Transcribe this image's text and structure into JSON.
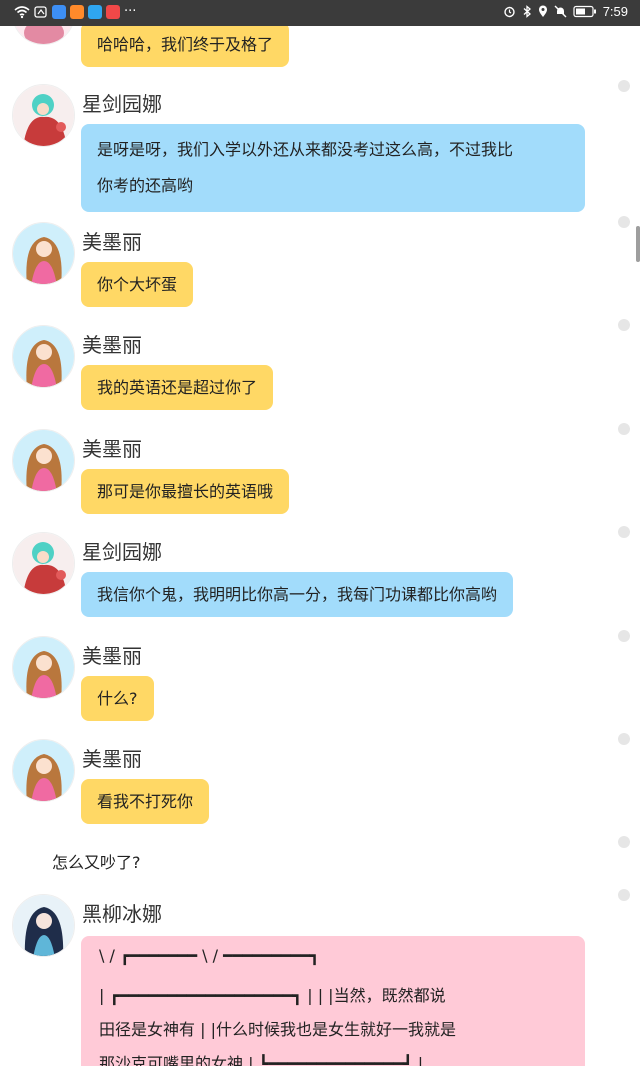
{
  "status_bar": {
    "time": "7:59",
    "overflow": "···",
    "icons": [
      "wifi-icon",
      "signal-icon",
      "cloud-app-icon",
      "orange-app-icon",
      "blue-app-icon",
      "red-app-icon",
      "alarm-icon",
      "bluetooth-icon",
      "location-icon",
      "mute-icon",
      "battery-icon"
    ]
  },
  "messages": [
    {
      "type": "bubble",
      "color": "yellow",
      "text": "哈哈哈，我们终于及格了"
    },
    {
      "type": "bubble",
      "color": "blue",
      "name": "星剑园娜",
      "lines": [
        "是呀是呀，我们入学以外还从来都没考过这么高，不过我比",
        "你考的还高哟"
      ]
    },
    {
      "type": "bubble",
      "color": "yellow",
      "name": "美墨丽",
      "text": "你个大坏蛋"
    },
    {
      "type": "bubble",
      "color": "yellow",
      "name": "美墨丽",
      "text": "我的英语还是超过你了"
    },
    {
      "type": "bubble",
      "color": "yellow",
      "name": "美墨丽",
      "text": "那可是你最擅长的英语哦"
    },
    {
      "type": "bubble",
      "color": "blue",
      "name": "星剑园娜",
      "text": "我信你个鬼，我明明比你高一分，我每门功课都比你高哟"
    },
    {
      "type": "bubble",
      "color": "yellow",
      "name": "美墨丽",
      "text": "什么?"
    },
    {
      "type": "bubble",
      "color": "yellow",
      "name": "美墨丽",
      "text": "看我不打死你"
    },
    {
      "type": "narration",
      "text": "怎么又吵了?"
    },
    {
      "type": "bubble",
      "color": "pink",
      "name": "黑柳冰娜",
      "art_lines": [
        "\\        /    ┏━━━━━━━ \\  / ━━━━━━━━━┓",
        "|  ┏━━━━━━━━━━━━━━━━━━┓  |    | |当然，既然都说",
        "田径是女神有  | |什么时候我也是女生就好一我就是",
        "那沙克可嘴里的女神  |  ┗━━━━━━━━━━━━━━┛  |"
      ]
    }
  ],
  "colors": {
    "yellow": "#ffd865",
    "blue": "#a2dcfb",
    "pink": "#ffcad7"
  }
}
